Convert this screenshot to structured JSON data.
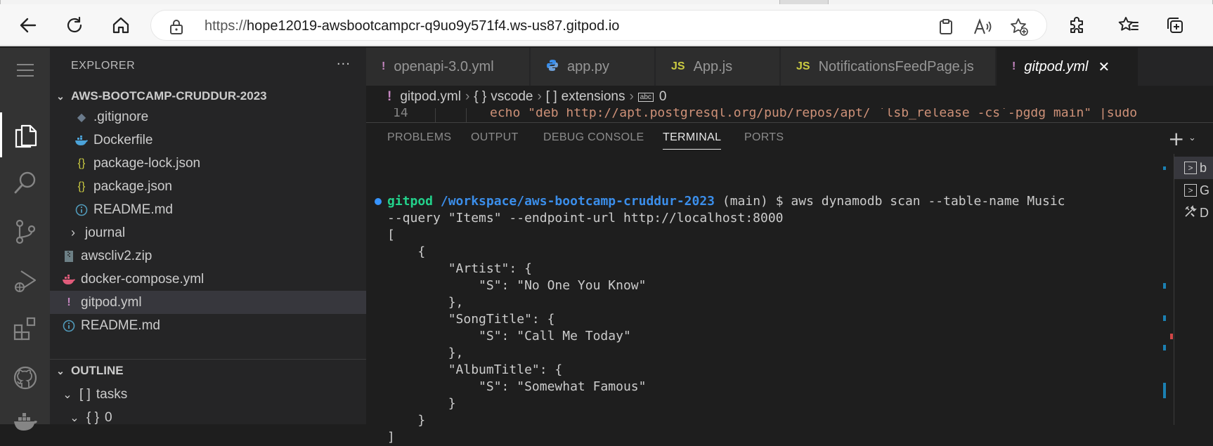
{
  "browser": {
    "url_protocol": "https://",
    "url_host": "hope12019-awsbootcampcr-q9uo9y571f4.ws-us87.gitpod.io"
  },
  "explorer": {
    "title": "EXPLORER",
    "more": "···",
    "root": "AWS-BOOTCAMP-CRUDDUR-2023",
    "items": [
      {
        "label": ".gitignore",
        "icon": "git-icon"
      },
      {
        "label": "Dockerfile",
        "icon": "docker-icon"
      },
      {
        "label": "package-lock.json",
        "icon": "json-icon"
      },
      {
        "label": "package.json",
        "icon": "json-icon"
      },
      {
        "label": "README.md",
        "icon": "info-icon"
      },
      {
        "label": "journal",
        "icon": "folder-chevron-icon"
      },
      {
        "label": "awscliv2.zip",
        "icon": "zip-icon"
      },
      {
        "label": "docker-compose.yml",
        "icon": "docker-icon"
      },
      {
        "label": "gitpod.yml",
        "icon": "yaml-icon"
      },
      {
        "label": "README.md",
        "icon": "info-icon"
      }
    ],
    "outline": {
      "title": "OUTLINE",
      "items": [
        {
          "label": "tasks",
          "symbol": "[ ]"
        },
        {
          "label": "0",
          "symbol": "{ }"
        }
      ]
    }
  },
  "tabs": [
    {
      "label": "openapi-3.0.yml",
      "icon": "!",
      "color": "#c586c0"
    },
    {
      "label": "app.py",
      "icon": "py",
      "color": "#3b8eea"
    },
    {
      "label": "App.js",
      "icon": "JS",
      "color": "#cbcb41"
    },
    {
      "label": "NotificationsFeedPage.js",
      "icon": "JS",
      "color": "#cbcb41"
    },
    {
      "label": "gitpod.yml",
      "icon": "!",
      "color": "#c586c0"
    }
  ],
  "breadcrumb": {
    "file": "gitpod.yml",
    "vscode_sym": "{ }",
    "vscode": "vscode",
    "ext_sym": "[ ]",
    "extensions": "extensions",
    "item_sym": "abc",
    "item": "0"
  },
  "code": {
    "line_number": "14",
    "text": "echo \"deb http://apt.postgresql.org/pub/repos/apt/ `lsb_release -cs`-pgdg main\" |sudo"
  },
  "panel_tabs": [
    "PROBLEMS",
    "OUTPUT",
    "DEBUG CONSOLE",
    "TERMINAL",
    "PORTS"
  ],
  "terminal": {
    "prompt_user": "gitpod",
    "prompt_path": "/workspace/aws-bootcamp-cruddur-2023",
    "prompt_branch": " (main) $ ",
    "command": "aws dynamodb scan --table-name Music",
    "command_cont": "--query \"Items\" --endpoint-url http://localhost:8000",
    "output": [
      "[",
      "    {",
      "        \"Artist\": {",
      "            \"S\": \"No One You Know\"",
      "        },",
      "        \"SongTitle\": {",
      "            \"S\": \"Call Me Today\"",
      "        },",
      "        \"AlbumTitle\": {",
      "            \"S\": \"Somewhat Famous\"",
      "        }",
      "    }",
      "]"
    ]
  },
  "terminal_list": [
    {
      "label": "b",
      "icon": ">"
    },
    {
      "label": "G",
      "icon": ">"
    },
    {
      "label": "D",
      "icon": "tools"
    }
  ]
}
